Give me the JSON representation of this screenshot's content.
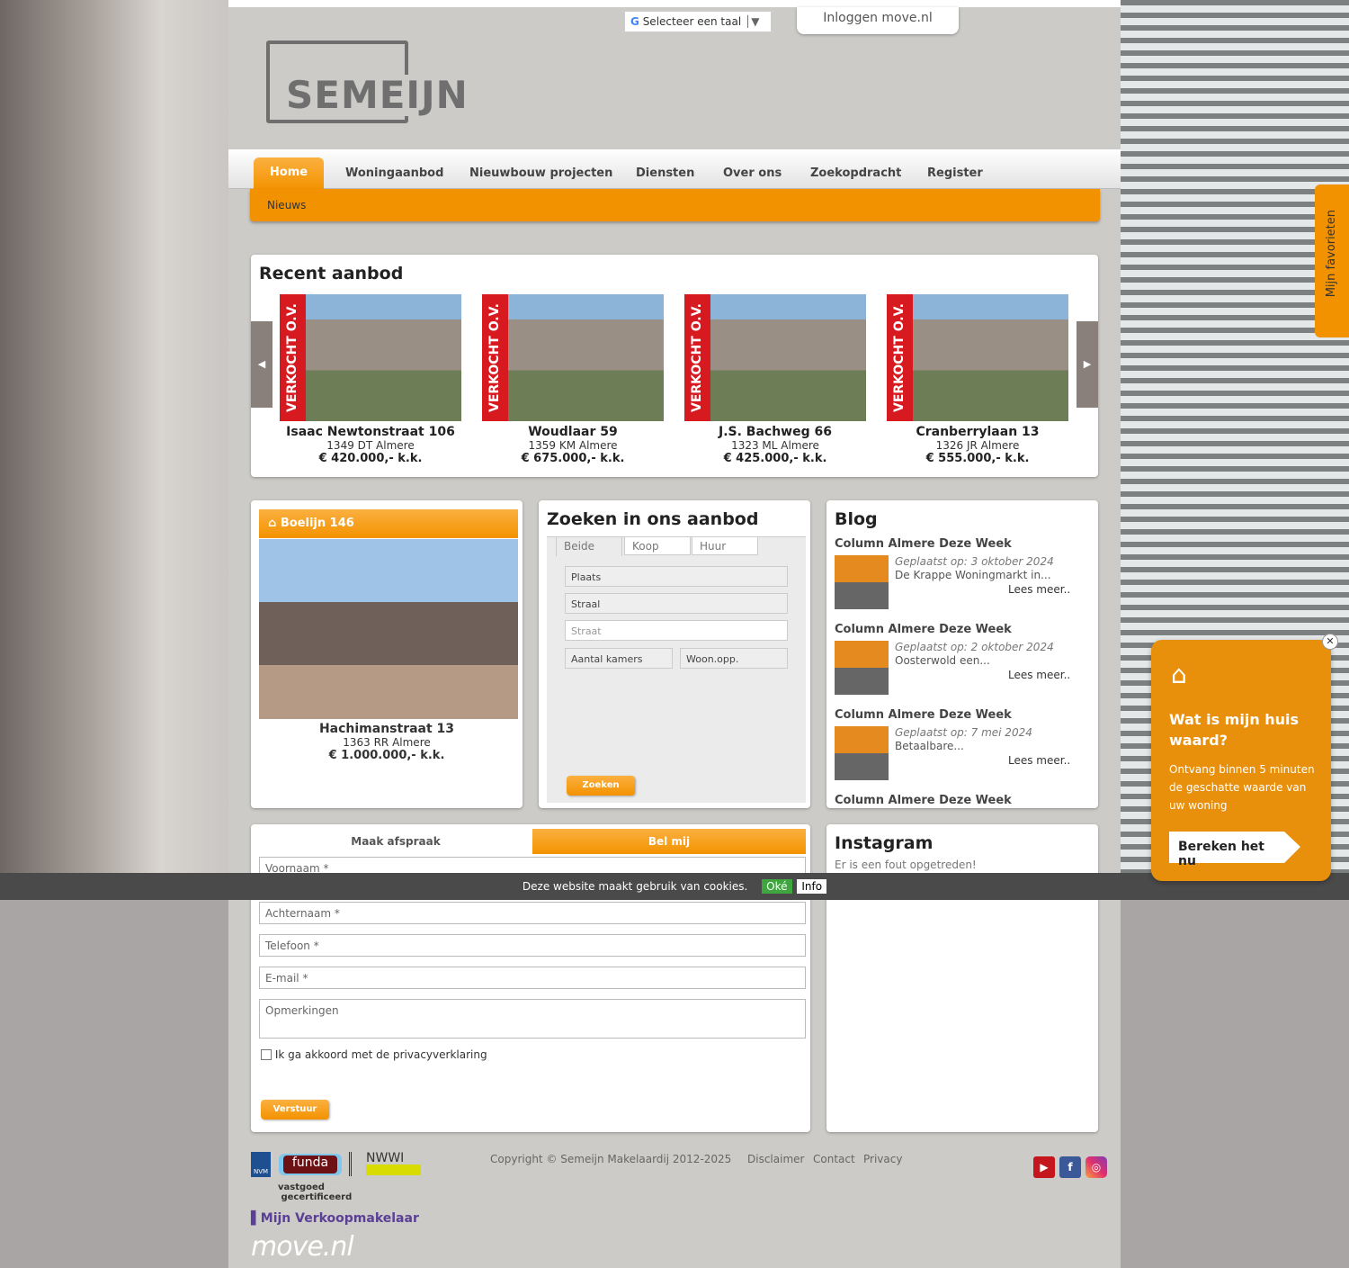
{
  "header": {
    "translate_label": "Selecteer een taal",
    "login_label": "Inloggen move.nl",
    "logo_text": "SEMEIJN"
  },
  "nav": {
    "items": [
      "Home",
      "Woningaanbod",
      "Nieuwbouw projecten",
      "Diensten",
      "Over ons",
      "Zoekopdracht",
      "Register"
    ],
    "sub_items": [
      "Nieuws"
    ]
  },
  "recent": {
    "title": "Recent aanbod",
    "ribbon": "VERKOCHT O.V.",
    "items": [
      {
        "street": "Isaac Newtonstraat 106",
        "city": "1349 DT Almere",
        "price": "€ 420.000,- k.k."
      },
      {
        "street": "Woudlaar 59",
        "city": "1359 KM Almere",
        "price": "€ 675.000,- k.k."
      },
      {
        "street": "J.S. Bachweg 66",
        "city": "1323 ML Almere",
        "price": "€ 425.000,- k.k."
      },
      {
        "street": "Cranberrylaan 13",
        "city": "1326 JR Almere",
        "price": "€ 555.000,- k.k."
      }
    ]
  },
  "featured": {
    "header": "Boelijn 146",
    "street": "Hachimanstraat 13",
    "city": "1363 RR Almere",
    "price": "€ 1.000.000,- k.k."
  },
  "search": {
    "title": "Zoeken in ons aanbod",
    "tabs": [
      "Beide",
      "Koop",
      "Huur"
    ],
    "fields": {
      "plaats": "Plaats",
      "straal": "Straal",
      "straat": "Straat",
      "kamers": "Aantal kamers",
      "woonopp": "Woon.opp."
    },
    "submit": "Zoeken"
  },
  "blog": {
    "title": "Blog",
    "items": [
      {
        "title": "Column Almere Deze Week",
        "date": "Geplaatst op: 3 oktober 2024",
        "excerpt": "De Krappe Woningmarkt in...",
        "more": "Lees meer.."
      },
      {
        "title": "Column Almere Deze Week",
        "date": "Geplaatst op: 2 oktober 2024",
        "excerpt": "Oosterwold een...",
        "more": "Lees meer.."
      },
      {
        "title": "Column Almere Deze Week",
        "date": "Geplaatst op: 7 mei 2024",
        "excerpt": "Betaalbare...",
        "more": "Lees meer.."
      },
      {
        "title": "Column Almere Deze Week"
      }
    ]
  },
  "contact": {
    "tabs": [
      "Maak afspraak",
      "Bel mij"
    ],
    "fields": [
      "Voornaam *",
      "Achternaam *",
      "Telefoon *",
      "E-mail *",
      "Opmerkingen"
    ],
    "consent": "Ik ga akkoord met de ",
    "consent_link": "privacyverklaring",
    "submit": "Verstuur"
  },
  "instagram": {
    "title": "Instagram",
    "error": "Er is een fout opgetreden!"
  },
  "cookie": {
    "text": "Deze website maakt gebruik van cookies.",
    "ok": "Oké",
    "info": "Info"
  },
  "favorites": {
    "label": "Mijn favorieten"
  },
  "valuation": {
    "title": "Wat is mijn huis waard?",
    "text": "Ontvang binnen 5 minuten de geschatte waarde van uw woning",
    "button": "Bereken het nu"
  },
  "footer": {
    "copyright": "Copyright © Semeijn Makelaardij 2012-2025",
    "links": [
      "Disclaimer",
      "Contact",
      "Privacy"
    ],
    "logos": [
      "NVM",
      "funda",
      "NWWI",
      "vastgoedcert gecertificeerd",
      "Mijn Verkoopmakelaar",
      "move.nl"
    ]
  },
  "colors": {
    "accent": "#f39200",
    "sold": "#d71920",
    "page_bg": "#cccbc7"
  }
}
